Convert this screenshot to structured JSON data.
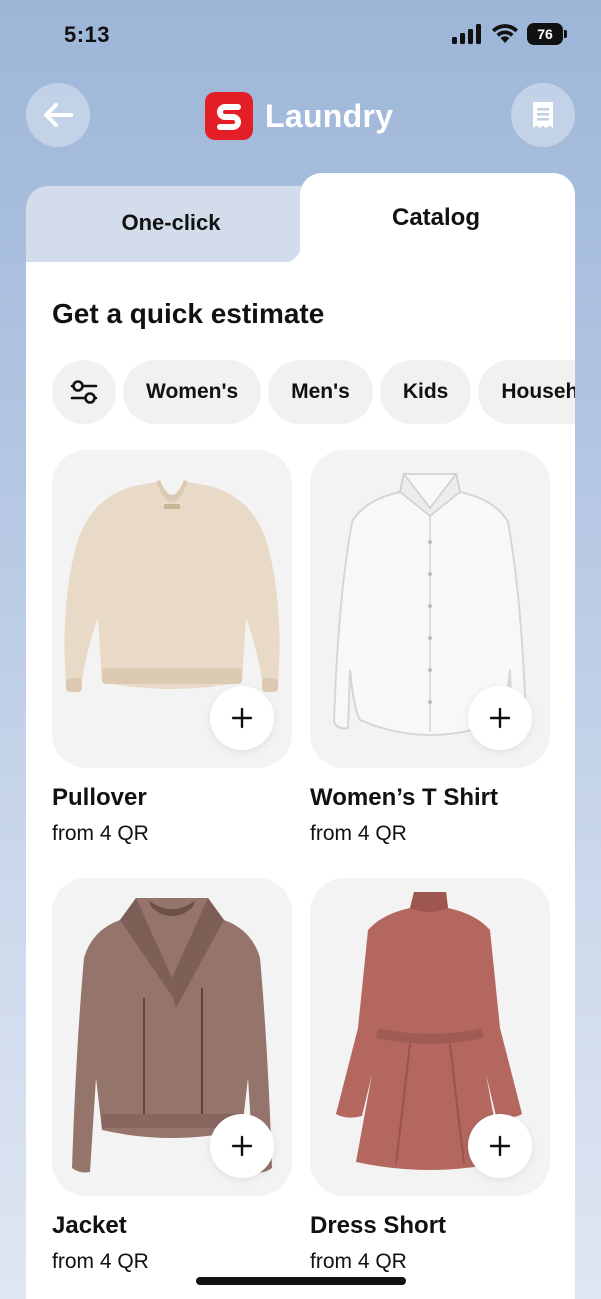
{
  "status_bar": {
    "time": "5:13",
    "battery": "76"
  },
  "header": {
    "brand_name": "Laundry",
    "brand_color": "#e41e26",
    "back_icon": "arrow-left-icon",
    "receipt_icon": "receipt-icon"
  },
  "tabs": [
    {
      "label": "One-click",
      "active": false
    },
    {
      "label": "Catalog",
      "active": true
    }
  ],
  "catalog": {
    "title": "Get a quick estimate",
    "filter_icon": "sliders-icon",
    "categories": [
      "Women's",
      "Men's",
      "Kids",
      "Household"
    ],
    "products": [
      {
        "name": "Pullover",
        "price": "from 4 QR",
        "icon": "pullover-image"
      },
      {
        "name": "Women’s T Shirt",
        "price": "from 4 QR",
        "icon": "shirt-image"
      },
      {
        "name": "Jacket",
        "price": "from 4 QR",
        "icon": "jacket-image"
      },
      {
        "name": "Dress Short",
        "price": "from 4 QR",
        "icon": "dress-image"
      }
    ]
  }
}
